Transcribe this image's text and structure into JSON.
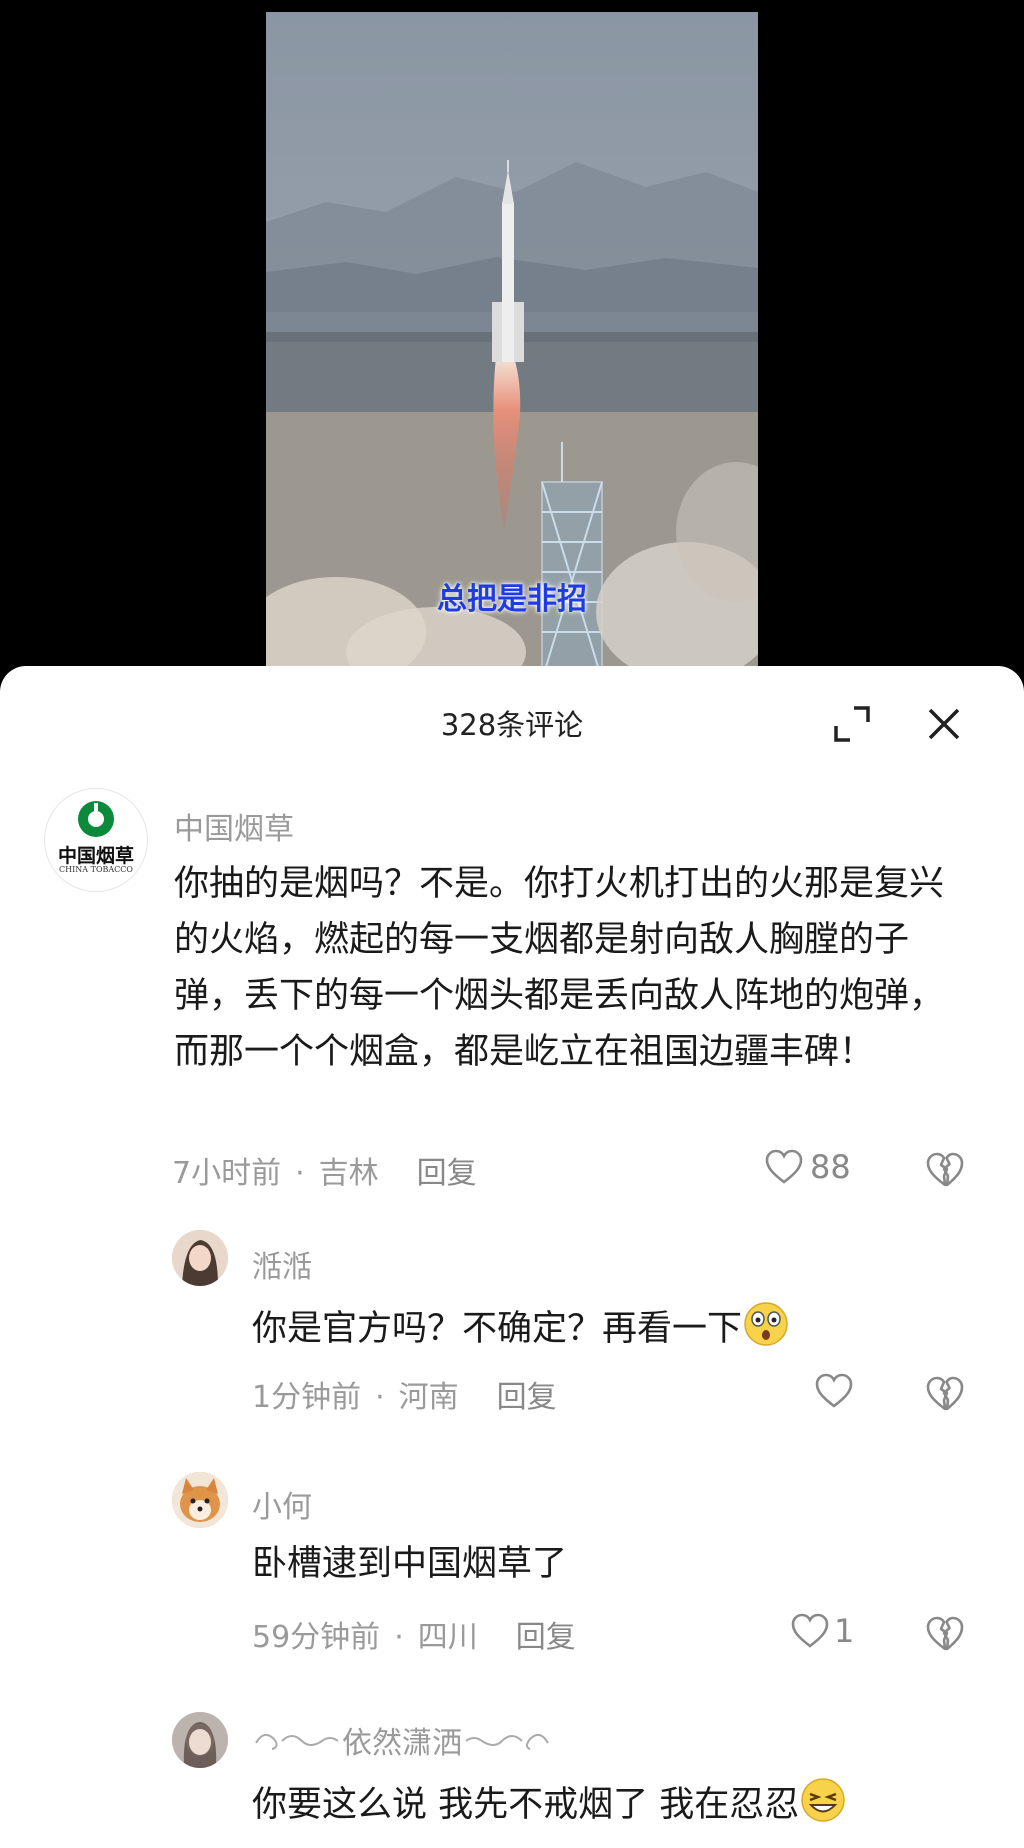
{
  "video": {
    "subtitle": "总把是非招"
  },
  "sheet": {
    "title": "328条评论",
    "expand_icon": "expand-icon",
    "close_icon": "close-icon"
  },
  "comments": [
    {
      "username": "中国烟草",
      "avatar_logo_text": "中国烟草",
      "avatar_logo_subtext": "CHINA TOBACCO",
      "text": "你抽的是烟吗？不是。你打火机打出的火那是复兴的火焰，燃起的每一支烟都是射向敌人胸膛的子弹，丢下的每一个烟头都是丢向敌人阵地的炮弹，而那一个个烟盒，都是屹立在祖国边疆丰碑！",
      "time": "7小时前",
      "location": "吉林",
      "reply": "回复",
      "likes": "88"
    },
    {
      "username": "湉湉",
      "text": "你是官方吗？不确定？再看一下",
      "emoji": "shocked-face-emoji",
      "time": "1分钟前",
      "location": "河南",
      "reply": "回复",
      "likes": ""
    },
    {
      "username": "小何",
      "text": "卧槽逮到中国烟草了",
      "time": "59分钟前",
      "location": "四川",
      "reply": "回复",
      "likes": "1"
    },
    {
      "username": "依然潇洒",
      "text": "你要这么说 我先不戒烟了 我在忍忍",
      "emoji": "grin-face-emoji"
    }
  ],
  "colors": {
    "sheet_bg": "#ffffff",
    "meta_text": "#9a9a9a",
    "subtitle": "#1f3ce0",
    "brand_green": "#0a8a3a"
  }
}
